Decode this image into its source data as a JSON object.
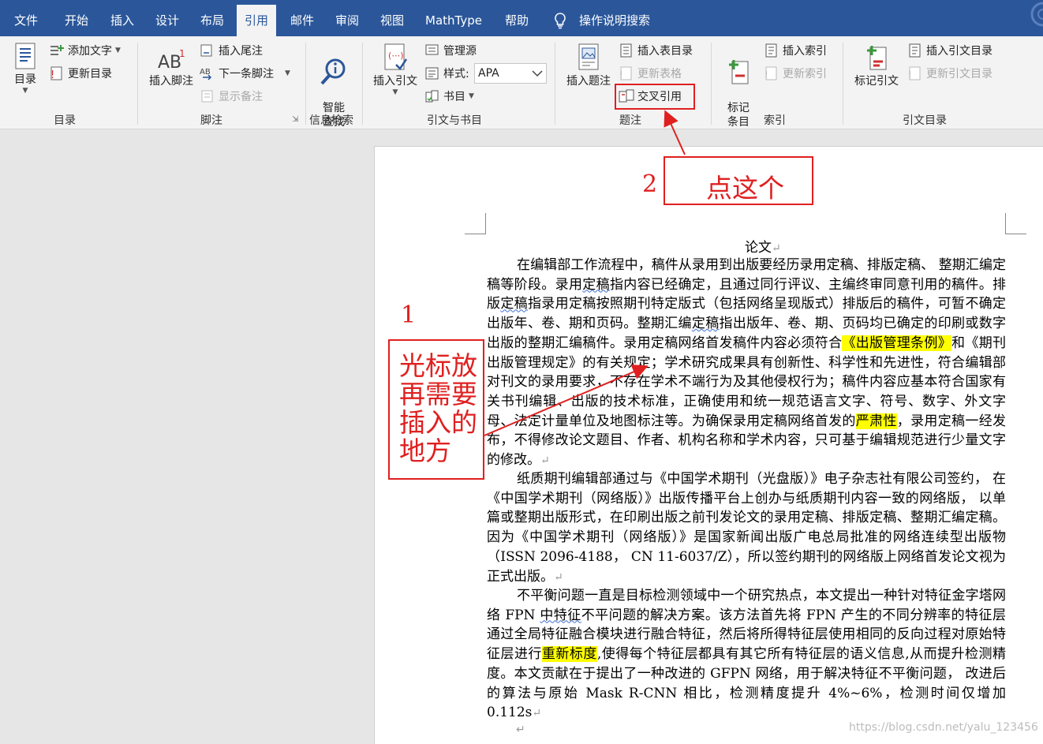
{
  "tabs": [
    {
      "label": "文件",
      "active": false
    },
    {
      "label": "开始",
      "active": false
    },
    {
      "label": "插入",
      "active": false
    },
    {
      "label": "设计",
      "active": false
    },
    {
      "label": "布局",
      "active": false
    },
    {
      "label": "引用",
      "active": true
    },
    {
      "label": "邮件",
      "active": false
    },
    {
      "label": "审阅",
      "active": false
    },
    {
      "label": "视图",
      "active": false
    },
    {
      "label": "MathType",
      "active": false
    },
    {
      "label": "帮助",
      "active": false
    }
  ],
  "tell_me": {
    "label": "操作说明搜索",
    "icon": "lightbulb-icon"
  },
  "ribbon": {
    "toc": {
      "group_label": "目录",
      "toc_button": "目录",
      "add_text": "添加文字",
      "update_toc": "更新目录"
    },
    "footnotes": {
      "group_label": "脚注",
      "insert_footnote": "插入脚注",
      "insert_endnote": "插入尾注",
      "next_footnote": "下一条脚注",
      "show_notes": "显示备注"
    },
    "research": {
      "group_label": "信息检索",
      "smart_lookup": "智能\n查找"
    },
    "citations": {
      "group_label": "引文与书目",
      "insert_citation": "插入引文",
      "manage_sources": "管理源",
      "style_label": "样式:",
      "style_value": "APA",
      "bibliography": "书目"
    },
    "captions": {
      "group_label": "题注",
      "insert_caption": "插入题注",
      "insert_table_of_figures": "插入表目录",
      "update_table": "更新表格",
      "cross_reference": "交叉引用"
    },
    "index": {
      "group_label": "索引",
      "mark_entry": "标记\n条目",
      "insert_index": "插入索引",
      "update_index": "更新索引"
    },
    "toa": {
      "group_label": "引文目录",
      "mark_citation": "标记引文",
      "insert_toa": "插入引文目录",
      "update_toa": "更新引文目录"
    }
  },
  "document": {
    "title": "论文",
    "p1": {
      "t1": "在编辑部工作流程中，稿件从录用到出版要经历录用定稿、排版定稿、 整期汇编定稿等阶段。录用",
      "t2": "定稿",
      "t3": "指内容已经确定，且通过同行评议、主编终审同意刊用的稿件。排版",
      "t4": "定稿",
      "t5": "指录用定稿按照期刊特定版式（包括网络呈现版式）排版后的稿件，可暂不确定出版年、卷、期和页码。整期汇编",
      "t6": "定稿",
      "t7": "指出版年、卷、期、页码均已确定的印刷或数字出版的整期汇编稿件。录用定稿网络首发稿件内容必须符合",
      "h1": "《出版管理条例》",
      "t8": "和《期刊出版管理规定》的有关规定；学术研究成果具有创新性、科学性和先进性，符合编辑部对刊文的录用要求，不存在学术不端行为及其他侵权行为；稿件内容应基本符合国家有关书刊编辑、出版的技术标准，正确使用和统一规范语言文字、符号、数字、外文字母、法定计量单位及地图标注等。为确保录用定稿网络首发的",
      "h2": "严肃性",
      "t9": "，录用定稿一经发布，不得修改论文题目、作者、机构名称和学术内容，只可基于编辑规范进行少量文字的修改。"
    },
    "p2": "纸质期刊编辑部通过与《中国学术期刊（光盘版）》电子杂志社有限公司签约， 在《中国学术期刊（网络版）》出版传播平台上创办与纸质期刊内容一致的网络版， 以单篇或整期出版形式，在印刷出版之前刊发论文的录用定稿、排版定稿、整期汇编定稿。 因为《中国学术期刊（网络版）》是国家新闻出版广电总局批准的网络连续型出版物（ISSN 2096-4188， CN 11-6037/Z），所以签约期刊的网络版上网络首发论文视为正式出版。",
    "p3": {
      "t1": "不平衡问题一直是目标检测领域中一个研究热点，本文提出一种针对特征金字塔网络 FPN ",
      "s1": "中特征",
      "t2": "不平问题的解决方案。该方法首先将 FPN 产生的不同分辨率的特征层通过全局特征融合模块进行融合特征，然后将所得特征层使用相同的反向过程对原始特征层进行",
      "h1": "重新标度",
      "t3": ",使得每个特征层都具有其它所有特征层的语义信息,从而提升检测精度。本文贡献在于提出了一种改进的 GFPN 网络，用于解决特征不平衡问题， 改进后的算法与原始 Mask R-CNN 相比，检测精度提升 4%~6%，检测时间仅增加 0.112s"
    },
    "return_mark": "↵"
  },
  "annotations": {
    "step1_number": "1",
    "step1_lines": [
      "光标放",
      "再需要",
      "插入的",
      "地方"
    ],
    "step2_number": "2",
    "step2_text": "点这个",
    "color": "#e02020"
  },
  "watermark": "https://blog.csdn.net/yalu_123456",
  "colors": {
    "title_bar": "#2b579a",
    "ribbon_bg": "#f3f3f3",
    "highlight": "#ffff00"
  }
}
